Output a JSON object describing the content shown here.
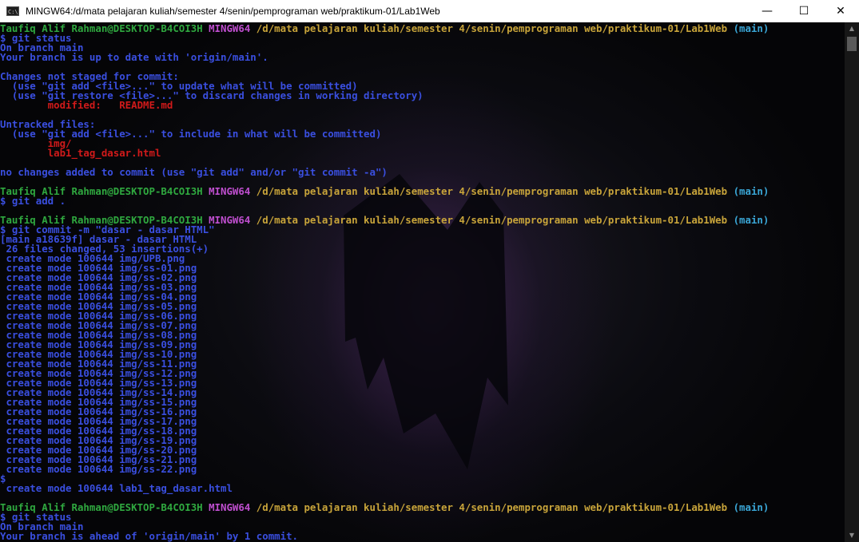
{
  "window": {
    "title": "MINGW64:/d/mata pelajaran kuliah/semester 4/senin/pemprograman web/praktikum-01/Lab1Web",
    "icon": "terminal-icon",
    "minimize_glyph": "—",
    "maximize_glyph": "☐",
    "close_glyph": "✕"
  },
  "colors": {
    "user": "#2fa83f",
    "shell": "#c04fd0",
    "path": "#c8a43a",
    "branch": "#3aa6d6",
    "output": "#3a4fe0",
    "error": "#d01a1a",
    "background": "#0b0b10"
  },
  "terminal": {
    "lines": [
      {
        "segments": [
          {
            "text": "Taufiq Alif Rahman@DESKTOP-B4COI3H ",
            "color": "green"
          },
          {
            "text": "MINGW64 ",
            "color": "magenta"
          },
          {
            "text": "/d/mata pelajaran kuliah/semester 4/senin/pemprograman web/praktikum-01/Lab1Web",
            "color": "yellow"
          },
          {
            "text": " (main)",
            "color": "cyan"
          }
        ]
      },
      {
        "segments": [
          {
            "text": "$ git status",
            "color": "blue"
          }
        ]
      },
      {
        "segments": [
          {
            "text": "On branch main",
            "color": "blue"
          }
        ]
      },
      {
        "segments": [
          {
            "text": "Your branch is up to date with 'origin/main'.",
            "color": "blue"
          }
        ]
      },
      {
        "segments": []
      },
      {
        "segments": [
          {
            "text": "Changes not staged for commit:",
            "color": "blue"
          }
        ]
      },
      {
        "segments": [
          {
            "text": "  (use \"git add <file>...\" to update what will be committed)",
            "color": "blue"
          }
        ]
      },
      {
        "segments": [
          {
            "text": "  (use \"git restore <file>...\" to discard changes in working directory)",
            "color": "blue"
          }
        ]
      },
      {
        "segments": [
          {
            "text": "        modified:   README.md",
            "color": "red"
          }
        ]
      },
      {
        "segments": []
      },
      {
        "segments": [
          {
            "text": "Untracked files:",
            "color": "blue"
          }
        ]
      },
      {
        "segments": [
          {
            "text": "  (use \"git add <file>...\" to include in what will be committed)",
            "color": "blue"
          }
        ]
      },
      {
        "segments": [
          {
            "text": "        img/",
            "color": "red"
          }
        ]
      },
      {
        "segments": [
          {
            "text": "        lab1_tag_dasar.html",
            "color": "red"
          }
        ]
      },
      {
        "segments": []
      },
      {
        "segments": [
          {
            "text": "no changes added to commit (use \"git add\" and/or \"git commit -a\")",
            "color": "blue"
          }
        ]
      },
      {
        "segments": []
      },
      {
        "segments": [
          {
            "text": "Taufiq Alif Rahman@DESKTOP-B4COI3H ",
            "color": "green"
          },
          {
            "text": "MINGW64 ",
            "color": "magenta"
          },
          {
            "text": "/d/mata pelajaran kuliah/semester 4/senin/pemprograman web/praktikum-01/Lab1Web",
            "color": "yellow"
          },
          {
            "text": " (main)",
            "color": "cyan"
          }
        ]
      },
      {
        "segments": [
          {
            "text": "$ git add .",
            "color": "blue"
          }
        ]
      },
      {
        "segments": []
      },
      {
        "segments": [
          {
            "text": "Taufiq Alif Rahman@DESKTOP-B4COI3H ",
            "color": "green"
          },
          {
            "text": "MINGW64 ",
            "color": "magenta"
          },
          {
            "text": "/d/mata pelajaran kuliah/semester 4/senin/pemprograman web/praktikum-01/Lab1Web",
            "color": "yellow"
          },
          {
            "text": " (main)",
            "color": "cyan"
          }
        ]
      },
      {
        "segments": [
          {
            "text": "$ git commit -m \"dasar - dasar HTML\"",
            "color": "blue"
          }
        ]
      },
      {
        "segments": [
          {
            "text": "[main a18639f] dasar - dasar HTML",
            "color": "blue"
          }
        ]
      },
      {
        "segments": [
          {
            "text": " 26 files changed, 53 insertions(+)",
            "color": "blue"
          }
        ]
      },
      {
        "segments": [
          {
            "text": " create mode 100644 img/UPB.png",
            "color": "blue"
          }
        ]
      },
      {
        "segments": [
          {
            "text": " create mode 100644 img/ss-01.png",
            "color": "blue"
          }
        ]
      },
      {
        "segments": [
          {
            "text": " create mode 100644 img/ss-02.png",
            "color": "blue"
          }
        ]
      },
      {
        "segments": [
          {
            "text": " create mode 100644 img/ss-03.png",
            "color": "blue"
          }
        ]
      },
      {
        "segments": [
          {
            "text": " create mode 100644 img/ss-04.png",
            "color": "blue"
          }
        ]
      },
      {
        "segments": [
          {
            "text": " create mode 100644 img/ss-05.png",
            "color": "blue"
          }
        ]
      },
      {
        "segments": [
          {
            "text": " create mode 100644 img/ss-06.png",
            "color": "blue"
          }
        ]
      },
      {
        "segments": [
          {
            "text": " create mode 100644 img/ss-07.png",
            "color": "blue"
          }
        ]
      },
      {
        "segments": [
          {
            "text": " create mode 100644 img/ss-08.png",
            "color": "blue"
          }
        ]
      },
      {
        "segments": [
          {
            "text": " create mode 100644 img/ss-09.png",
            "color": "blue"
          }
        ]
      },
      {
        "segments": [
          {
            "text": " create mode 100644 img/ss-10.png",
            "color": "blue"
          }
        ]
      },
      {
        "segments": [
          {
            "text": " create mode 100644 img/ss-11.png",
            "color": "blue"
          }
        ]
      },
      {
        "segments": [
          {
            "text": " create mode 100644 img/ss-12.png",
            "color": "blue"
          }
        ]
      },
      {
        "segments": [
          {
            "text": " create mode 100644 img/ss-13.png",
            "color": "blue"
          }
        ]
      },
      {
        "segments": [
          {
            "text": " create mode 100644 img/ss-14.png",
            "color": "blue"
          }
        ]
      },
      {
        "segments": [
          {
            "text": " create mode 100644 img/ss-15.png",
            "color": "blue"
          }
        ]
      },
      {
        "segments": [
          {
            "text": " create mode 100644 img/ss-16.png",
            "color": "blue"
          }
        ]
      },
      {
        "segments": [
          {
            "text": " create mode 100644 img/ss-17.png",
            "color": "blue"
          }
        ]
      },
      {
        "segments": [
          {
            "text": " create mode 100644 img/ss-18.png",
            "color": "blue"
          }
        ]
      },
      {
        "segments": [
          {
            "text": " create mode 100644 img/ss-19.png",
            "color": "blue"
          }
        ]
      },
      {
        "segments": [
          {
            "text": " create mode 100644 img/ss-20.png",
            "color": "blue"
          }
        ]
      },
      {
        "segments": [
          {
            "text": " create mode 100644 img/ss-21.png",
            "color": "blue"
          }
        ]
      },
      {
        "segments": [
          {
            "text": " create mode 100644 img/ss-22.png",
            "color": "blue"
          }
        ]
      },
      {
        "segments": [
          {
            "text": "$",
            "color": "blue"
          }
        ]
      },
      {
        "segments": [
          {
            "text": " create mode 100644 lab1_tag_dasar.html",
            "color": "blue"
          }
        ]
      },
      {
        "segments": []
      },
      {
        "segments": [
          {
            "text": "Taufiq Alif Rahman@DESKTOP-B4COI3H ",
            "color": "green"
          },
          {
            "text": "MINGW64 ",
            "color": "magenta"
          },
          {
            "text": "/d/mata pelajaran kuliah/semester 4/senin/pemprograman web/praktikum-01/Lab1Web",
            "color": "yellow"
          },
          {
            "text": " (main)",
            "color": "cyan"
          }
        ]
      },
      {
        "segments": [
          {
            "text": "$ git status",
            "color": "blue"
          }
        ]
      },
      {
        "segments": [
          {
            "text": "On branch main",
            "color": "blue"
          }
        ]
      },
      {
        "segments": [
          {
            "text": "Your branch is ahead of 'origin/main' by 1 commit.",
            "color": "blue"
          }
        ]
      }
    ]
  },
  "scrollbar": {
    "up_arrow": "▲",
    "down_arrow": "▼"
  }
}
